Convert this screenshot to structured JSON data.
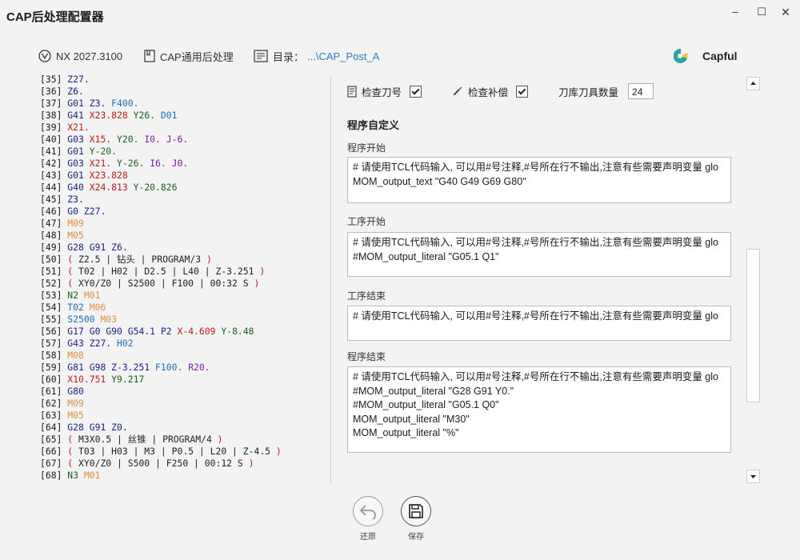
{
  "window": {
    "title": "CAP后处理配置器",
    "min": "–",
    "max": "☐",
    "close": "✕"
  },
  "info": {
    "nx_version": "NX 2027.3100",
    "post_name": "CAP通用后处理",
    "dir_label": "目录：",
    "dir_value": "...\\CAP_Post_A"
  },
  "brand": {
    "name": "Capful"
  },
  "code_lines": [
    {
      "n": "[35]",
      "t": [
        [
          "Z27.",
          "#1a237e"
        ]
      ]
    },
    {
      "n": "[36]",
      "t": [
        [
          "Z6.",
          "#1a237e"
        ]
      ]
    },
    {
      "n": "[37]",
      "t": [
        [
          "G01 ",
          "#1a237e"
        ],
        [
          "Z3. ",
          "#1a237e"
        ],
        [
          "F400.",
          "#1e6fb0"
        ]
      ]
    },
    {
      "n": "[38]",
      "t": [
        [
          "G41 ",
          "#1a237e"
        ],
        [
          "X23.828 ",
          "#b71c1c"
        ],
        [
          "Y26. ",
          "#1b5e20"
        ],
        [
          "D01",
          "#1e6fb0"
        ]
      ]
    },
    {
      "n": "[39]",
      "t": [
        [
          "X21.",
          "#b71c1c"
        ]
      ]
    },
    {
      "n": "[40]",
      "t": [
        [
          "G03 ",
          "#1a237e"
        ],
        [
          "X15. ",
          "#b71c1c"
        ],
        [
          "Y20. ",
          "#1b5e20"
        ],
        [
          "I0. ",
          "#7b1fa2"
        ],
        [
          "J-6.",
          "#7b1fa2"
        ]
      ]
    },
    {
      "n": "[41]",
      "t": [
        [
          "G01 ",
          "#1a237e"
        ],
        [
          "Y-20.",
          "#1b5e20"
        ]
      ]
    },
    {
      "n": "[42]",
      "t": [
        [
          "G03 ",
          "#1a237e"
        ],
        [
          "X21. ",
          "#b71c1c"
        ],
        [
          "Y-26. ",
          "#1b5e20"
        ],
        [
          "I6. ",
          "#7b1fa2"
        ],
        [
          "J0.",
          "#7b1fa2"
        ]
      ]
    },
    {
      "n": "[43]",
      "t": [
        [
          "G01 ",
          "#1a237e"
        ],
        [
          "X23.828",
          "#b71c1c"
        ]
      ]
    },
    {
      "n": "[44]",
      "t": [
        [
          "G40 ",
          "#1a237e"
        ],
        [
          "X24.813 ",
          "#b71c1c"
        ],
        [
          "Y-20.826",
          "#1b5e20"
        ]
      ]
    },
    {
      "n": "[45]",
      "t": [
        [
          "Z3.",
          "#1a237e"
        ]
      ]
    },
    {
      "n": "[46]",
      "t": [
        [
          "G0 ",
          "#1a237e"
        ],
        [
          "Z27.",
          "#1a237e"
        ]
      ]
    },
    {
      "n": "[47]",
      "t": [
        [
          "M09",
          "#e09040"
        ]
      ]
    },
    {
      "n": "[48]",
      "t": [
        [
          "M05",
          "#e09040"
        ]
      ]
    },
    {
      "n": "[49]",
      "t": [
        [
          "G28 ",
          "#1a237e"
        ],
        [
          "G91 ",
          "#1a237e"
        ],
        [
          "Z6.",
          "#1a237e"
        ]
      ]
    },
    {
      "n": "[50]",
      "t": [
        [
          "( ",
          "#b71c1c"
        ],
        [
          "Z2.5 | 钻头 | PROGRAM/3 ",
          "#222222"
        ],
        [
          ")",
          "#b71c1c"
        ]
      ]
    },
    {
      "n": "[51]",
      "t": [
        [
          "( ",
          "#b71c1c"
        ],
        [
          "T02 | H02 | D2.5 | L40 | Z-3.251 ",
          "#222222"
        ],
        [
          ")",
          "#b71c1c"
        ]
      ]
    },
    {
      "n": "[52]",
      "t": [
        [
          "( ",
          "#b71c1c"
        ],
        [
          "XY0/Z0 | S2500 | F100 | 00:32 S ",
          "#222222"
        ],
        [
          ")",
          "#b71c1c"
        ]
      ]
    },
    {
      "n": "[53]",
      "t": [
        [
          "N2 ",
          "#1b5e20"
        ],
        [
          "M01",
          "#e09040"
        ]
      ]
    },
    {
      "n": "[54]",
      "t": [
        [
          "T02 ",
          "#1e6fb0"
        ],
        [
          "M06",
          "#e09040"
        ]
      ]
    },
    {
      "n": "[55]",
      "t": [
        [
          "S2500 ",
          "#1e6fb0"
        ],
        [
          "M03",
          "#e09040"
        ]
      ]
    },
    {
      "n": "[56]",
      "t": [
        [
          "G17 ",
          "#1a237e"
        ],
        [
          "G0 ",
          "#1a237e"
        ],
        [
          "G90 ",
          "#1a237e"
        ],
        [
          "G54.1 ",
          "#1a237e"
        ],
        [
          "P2 ",
          "#1a237e"
        ],
        [
          "X-4.609 ",
          "#b71c1c"
        ],
        [
          "Y-8.48",
          "#1b5e20"
        ]
      ]
    },
    {
      "n": "[57]",
      "t": [
        [
          "G43 ",
          "#1a237e"
        ],
        [
          "Z27. ",
          "#1a237e"
        ],
        [
          "H02",
          "#1e6fb0"
        ]
      ]
    },
    {
      "n": "[58]",
      "t": [
        [
          "M08",
          "#e09040"
        ]
      ]
    },
    {
      "n": "[59]",
      "t": [
        [
          "G81 ",
          "#1a237e"
        ],
        [
          "G98 ",
          "#1a237e"
        ],
        [
          "Z-3.251 ",
          "#1a237e"
        ],
        [
          "F100. ",
          "#1e6fb0"
        ],
        [
          "R20.",
          "#7b1fa2"
        ]
      ]
    },
    {
      "n": "[60]",
      "t": [
        [
          "X10.751 ",
          "#b71c1c"
        ],
        [
          "Y9.217",
          "#1b5e20"
        ]
      ]
    },
    {
      "n": "[61]",
      "t": [
        [
          "G80",
          "#1a237e"
        ]
      ]
    },
    {
      "n": "[62]",
      "t": [
        [
          "M09",
          "#e09040"
        ]
      ]
    },
    {
      "n": "[63]",
      "t": [
        [
          "M05",
          "#e09040"
        ]
      ]
    },
    {
      "n": "[64]",
      "t": [
        [
          "G28 ",
          "#1a237e"
        ],
        [
          "G91 ",
          "#1a237e"
        ],
        [
          "Z0.",
          "#1a237e"
        ]
      ]
    },
    {
      "n": "[65]",
      "t": [
        [
          "( ",
          "#b71c1c"
        ],
        [
          "M3X0.5 | 丝锥 | PROGRAM/4 ",
          "#222222"
        ],
        [
          ")",
          "#b71c1c"
        ]
      ]
    },
    {
      "n": "[66]",
      "t": [
        [
          "( ",
          "#b71c1c"
        ],
        [
          "T03 | H03 | M3 | P0.5 | L20 | Z-4.5 ",
          "#222222"
        ],
        [
          ")",
          "#b71c1c"
        ]
      ]
    },
    {
      "n": "[67]",
      "t": [
        [
          "( ",
          "#b71c1c"
        ],
        [
          "XY0/Z0 | S500 | F250 | 00:12 S ",
          "#222222"
        ],
        [
          ")",
          "#b71c1c"
        ]
      ]
    },
    {
      "n": "[68]",
      "t": [
        [
          "N3 ",
          "#1b5e20"
        ],
        [
          "M01",
          "#e09040"
        ]
      ]
    }
  ],
  "options": {
    "check_tool_label": "检查刀号",
    "check_comp_label": "检查补偿",
    "magazine_label": "刀库刀具数量",
    "magazine_value": "24"
  },
  "custom": {
    "title": "程序自定义",
    "program_start_label": "程序开始",
    "program_start_lines": [
      "# 请使用TCL代码输入, 可以用#号注释,#号所在行不输出,注意有些需要声明变量 glo",
      "MOM_output_text \"G40 G49 G69 G80\""
    ],
    "op_start_label": "工序开始",
    "op_start_lines": [
      "# 请使用TCL代码输入, 可以用#号注释,#号所在行不输出,注意有些需要声明变量 glo",
      "#MOM_output_literal \"G05.1 Q1\""
    ],
    "op_end_label": "工序结束",
    "op_end_lines": [
      "# 请使用TCL代码输入, 可以用#号注释,#号所在行不输出,注意有些需要声明变量 glo"
    ],
    "program_end_label": "程序结束",
    "program_end_lines": [
      "# 请使用TCL代码输入, 可以用#号注释,#号所在行不输出,注意有些需要声明变量 glo",
      "#MOM_output_literal \"G28 G91 Y0.\"",
      "#MOM_output_literal \"G05.1 Q0\"",
      "MOM_output_literal \"M30\"",
      "MOM_output_literal \"%\""
    ]
  },
  "buttons": {
    "undo_label": "还原",
    "save_label": "保存"
  }
}
